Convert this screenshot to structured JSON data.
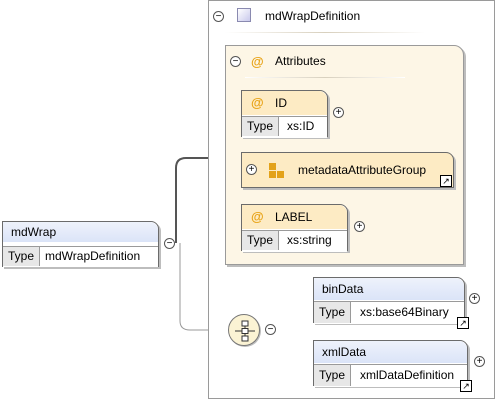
{
  "root": {
    "name": "mdWrap",
    "type_label": "Type",
    "type_value": "mdWrapDefinition"
  },
  "complex_type": {
    "name": "mdWrapDefinition"
  },
  "attributes": {
    "header": "Attributes",
    "items": [
      {
        "name": "ID",
        "type_label": "Type",
        "type_value": "xs:ID"
      },
      {
        "name": "LABEL",
        "type_label": "Type",
        "type_value": "xs:string"
      }
    ],
    "group": {
      "name": "metadataAttributeGroup"
    }
  },
  "children": [
    {
      "name": "binData",
      "type_label": "Type",
      "type_value": "xs:base64Binary"
    },
    {
      "name": "xmlData",
      "type_label": "Type",
      "type_value": "xmlDataDefinition"
    }
  ],
  "glyphs": {
    "collapse": "−",
    "expand": "+",
    "ref": "↗",
    "at": "@"
  },
  "colors": {
    "element_head": "#dbe4f8",
    "attribute_head": "#fdebc4",
    "panel": "#fdf6e6"
  }
}
